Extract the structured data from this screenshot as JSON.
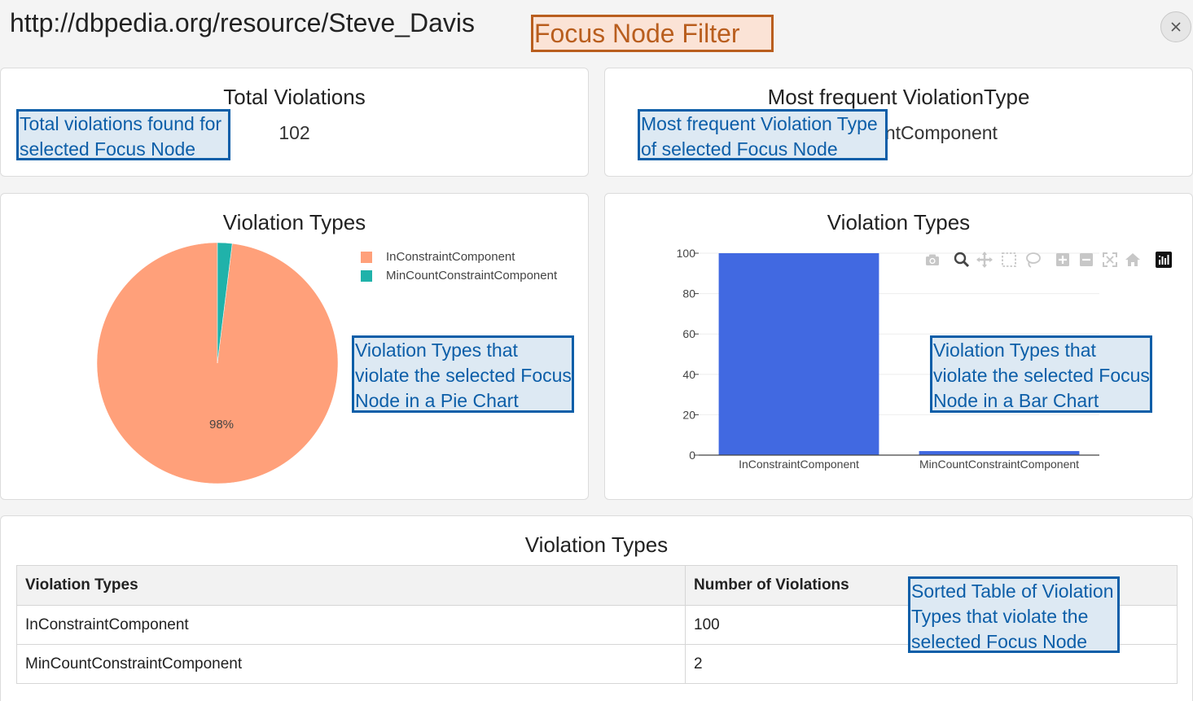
{
  "header": {
    "title": "http://dbpedia.org/resource/Steve_Davis",
    "filter_label": "Focus Node Filter",
    "close_label": "×"
  },
  "total_card": {
    "title": "Total Violations",
    "value": "102",
    "note": "Total violations found  for\nselected Focus Node"
  },
  "frequent_card": {
    "title": "Most frequent ViolationType",
    "value": "InConstraintComponent",
    "note": "Most frequent Violation Type\nof selected Focus Node"
  },
  "pie_card": {
    "title": "Violation Types",
    "note": "Violation Types that\nviolate the selected Focus\nNode in a Pie Chart"
  },
  "bar_card": {
    "title": "Violation Types",
    "note": "Violation Types that\nviolate the selected Focus\nNode in a Bar Chart"
  },
  "table_card": {
    "title": "Violation Types",
    "note": "Sorted Table of Violation\nTypes that violate the\nselected Focus Node",
    "columns": [
      "Violation Types",
      "Number of Violations"
    ],
    "rows": [
      [
        "InConstraintComponent",
        "100"
      ],
      [
        "MinCountConstraintComponent",
        "2"
      ]
    ]
  },
  "toolbar": {
    "icons": [
      "camera-icon",
      "zoom-icon",
      "pan-icon",
      "box-select-icon",
      "lasso-select-icon",
      "zoom-in-icon",
      "zoom-out-icon",
      "autoscale-icon",
      "reset-axes-icon",
      "plotly-logo-icon"
    ]
  },
  "colors": {
    "in_constraint": "#FFA07A",
    "min_count": "#20B2AA",
    "bar": "#4169E1",
    "callout_blue": "#0c5ea8",
    "callout_orange": "#b95e1e"
  },
  "chart_data": [
    {
      "type": "pie",
      "title": "Violation Types",
      "labels": [
        "InConstraintComponent",
        "MinCountConstraintComponent"
      ],
      "values": [
        100,
        2
      ],
      "slice_text": [
        "98%",
        ""
      ],
      "legend": "top-right"
    },
    {
      "type": "bar",
      "title": "Violation Types",
      "categories": [
        "InConstraintComponent",
        "MinCountConstraintComponent"
      ],
      "values": [
        100,
        2
      ],
      "yticks": [
        "0",
        "20",
        "40",
        "60",
        "80",
        "100"
      ],
      "ylim": [
        0,
        100
      ],
      "grid": true
    }
  ]
}
